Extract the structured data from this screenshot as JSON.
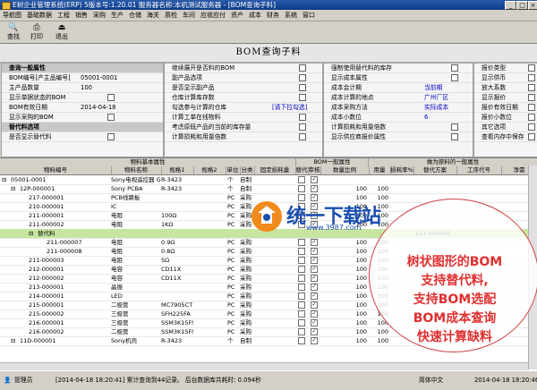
{
  "window": {
    "title": "E树企业管理系统(ERP) 5版本号:1.20.01 服务器名称:本机测试服务器 - [BOM查询子料]"
  },
  "menu": [
    "导航图",
    "基础数据",
    "工程",
    "销售",
    "采购",
    "生产",
    "仓储",
    "海关",
    "质检",
    "车间",
    "应收应付",
    "资产",
    "成本",
    "财务",
    "系统",
    "窗口"
  ],
  "toolbar": {
    "search_label": "查找",
    "print_label": "打印",
    "exit_label": "退出"
  },
  "form_title": "BOM查询子料",
  "panel1": {
    "header": "查询一般属性",
    "rows": [
      {
        "label": "BOM编号[产主品编号]",
        "value": "05001-0001"
      },
      {
        "label": "主产品数量",
        "value": "100"
      },
      {
        "label": "显示单据状态的BOM",
        "value": ""
      },
      {
        "label": "BOM有效日期",
        "value": "2014-04-18"
      },
      {
        "label": "显示采购的BOM",
        "value": ""
      }
    ],
    "header2": "替代料选项",
    "row_sub": "是否显示替代料"
  },
  "panel2": {
    "rows": [
      {
        "label": "继续展开是否料的BOM",
        "value": ""
      },
      {
        "label": "副产品选项",
        "value": ""
      },
      {
        "label": "是否显示副产品",
        "value": ""
      },
      {
        "label": "仓库计算库存数",
        "value": ""
      },
      {
        "label": "勾选参与计算的仓库",
        "value": "[请下拉勾选]"
      },
      {
        "label": "计算工单在线物料",
        "value": ""
      },
      {
        "label": "考虑原既产品的当前的库存量",
        "value": ""
      },
      {
        "label": "计算损耗和用量倍数",
        "value": ""
      }
    ]
  },
  "panel3": {
    "rows": [
      {
        "label": "强制使用替代料的库存",
        "value": ""
      },
      {
        "label": "显示成本属性",
        "value": ""
      },
      {
        "label": "成本会计期",
        "value": "当前期"
      },
      {
        "label": "成本计算的地点",
        "value": "广州厂区"
      },
      {
        "label": "成本采购方法",
        "value": "实际成本"
      },
      {
        "label": "成本小数位",
        "value": "6"
      },
      {
        "label": "计算损耗和用量倍数",
        "value": ""
      },
      {
        "label": "显示供应商报价属性",
        "value": ""
      }
    ]
  },
  "panel4": {
    "rows": [
      {
        "label": "报价类型",
        "value": ""
      },
      {
        "label": "显示供币",
        "value": ""
      },
      {
        "label": "放大系数",
        "value": ""
      },
      {
        "label": "显示报价",
        "value": ""
      },
      {
        "label": "报价有效日期",
        "value": ""
      },
      {
        "label": "报价小数位",
        "value": ""
      },
      {
        "label": "其它选项",
        "value": ""
      },
      {
        "label": "查看内存中保存",
        "value": ""
      }
    ]
  },
  "grid": {
    "group_headers": [
      "物料基本属性",
      "BOM一般属性",
      "做为原料的一般属性"
    ],
    "columns": [
      "物料编号",
      "物料名称",
      "规格1",
      "规格2",
      "单位",
      "分类",
      "固定损耗量",
      "替代",
      "审核",
      "数量比例",
      "用量",
      "损耗率%",
      "替代方案",
      "工序代号",
      "净需"
    ],
    "rows": [
      {
        "indent": 0,
        "code": "05001-0001",
        "name": "Sony电视遥控器 G",
        "spec1": "R-3423",
        "unit": "个",
        "cat": "自制",
        "qty": "",
        "sel": false
      },
      {
        "indent": 1,
        "code": "12P-000001",
        "name": "Sony PCBA",
        "spec1": "R-3423",
        "unit": "个",
        "cat": "自制",
        "qty": "100",
        "sel": false
      },
      {
        "indent": 2,
        "code": "217-000001",
        "name": "PCB线路板",
        "spec1": "",
        "unit": "PC",
        "cat": "采购",
        "qty": "100",
        "sel": false
      },
      {
        "indent": 2,
        "code": "210-000001",
        "name": "IC",
        "spec1": "",
        "unit": "PC",
        "cat": "采购",
        "qty": "100",
        "sel": false
      },
      {
        "indent": 2,
        "code": "211-000001",
        "name": "电阻",
        "spec1": "100Ω",
        "unit": "PC",
        "cat": "采购",
        "qty": "100",
        "sel": false
      },
      {
        "indent": 2,
        "code": "211-000002",
        "name": "电阻",
        "spec1": "1KΩ",
        "unit": "PC",
        "cat": "采购",
        "qty": "100",
        "sel": false
      },
      {
        "indent": 3,
        "code": "替代料",
        "name": "",
        "spec1": "",
        "unit": "",
        "cat": "",
        "qty": "",
        "sel": true
      },
      {
        "indent": 4,
        "code": "211-000007",
        "name": "电阻",
        "spec1": "0.9Ω",
        "unit": "PC",
        "cat": "采购",
        "qty": "100",
        "sel": false
      },
      {
        "indent": 4,
        "code": "211-000008",
        "name": "电阻",
        "spec1": "0.8Ω",
        "unit": "PC",
        "cat": "采购",
        "qty": "100",
        "sel": false
      },
      {
        "indent": 2,
        "code": "211-000003",
        "name": "电阻",
        "spec1": "5Ω",
        "unit": "PC",
        "cat": "采购",
        "qty": "100",
        "sel": false
      },
      {
        "indent": 2,
        "code": "212-000001",
        "name": "电容",
        "spec1": "CD11X",
        "unit": "PC",
        "cat": "采购",
        "qty": "100",
        "sel": false
      },
      {
        "indent": 2,
        "code": "212-000002",
        "name": "电容",
        "spec1": "CD11X",
        "unit": "PC",
        "cat": "采购",
        "qty": "100",
        "sel": false
      },
      {
        "indent": 2,
        "code": "213-000001",
        "name": "晶振",
        "spec1": "",
        "unit": "PC",
        "cat": "采购",
        "qty": "100",
        "sel": false
      },
      {
        "indent": 2,
        "code": "214-000001",
        "name": "LED",
        "spec1": "",
        "unit": "PC",
        "cat": "采购",
        "qty": "100",
        "sel": false
      },
      {
        "indent": 2,
        "code": "215-000001",
        "name": "二极管",
        "spec1": "MC7905CT",
        "unit": "PC",
        "cat": "采购",
        "qty": "100",
        "sel": false
      },
      {
        "indent": 2,
        "code": "215-000002",
        "name": "三极管",
        "spec1": "SFH225FA",
        "unit": "PC",
        "cat": "采购",
        "qty": "100",
        "sel": false
      },
      {
        "indent": 2,
        "code": "216-000001",
        "name": "三极管",
        "spec1": "SSM3K15FS",
        "unit": "PC",
        "cat": "采购",
        "qty": "100",
        "sel": false
      },
      {
        "indent": 2,
        "code": "216-000002",
        "name": "二极管",
        "spec1": "SSM3K15FS",
        "unit": "PC",
        "cat": "采购",
        "qty": "100",
        "sel": false
      },
      {
        "indent": 1,
        "code": "11D-000001",
        "name": "Sony机壳",
        "spec1": "R-3423",
        "unit": "个",
        "cat": "自制",
        "qty": "100",
        "sel": false
      }
    ],
    "side_code": "211-000002"
  },
  "watermark": {
    "brand": "统一下载站",
    "url": "www.3987.com"
  },
  "promo": {
    "lines": [
      "树状图形的BOM",
      "支持替代料,",
      "支持BOM选配",
      "BOM成本查询",
      "快速计算缺料"
    ]
  },
  "status": {
    "user": "管理员",
    "message": "[2014-04-18 18:20:41] 累计查询到44记录。 后台数据库共耗时: 0.094秒",
    "lang": "简体中文",
    "time": "2014-04-18 18:20:46"
  }
}
